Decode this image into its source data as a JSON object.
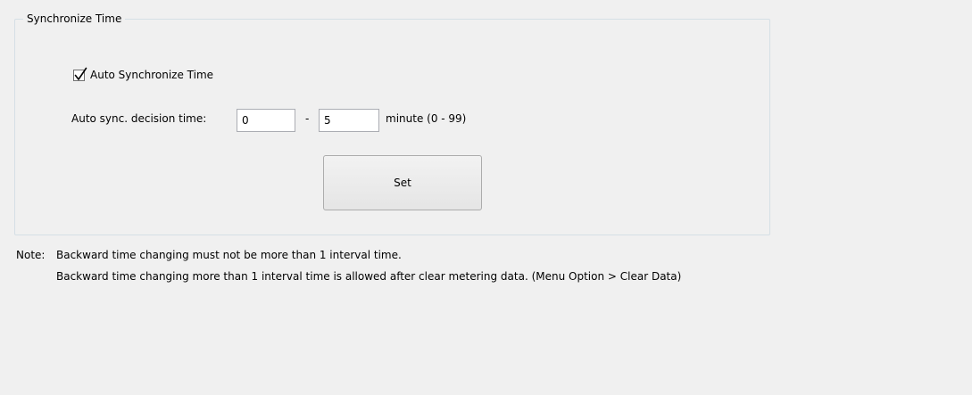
{
  "group": {
    "title": "Synchronize Time"
  },
  "auto_sync": {
    "label": "Auto Synchronize Time",
    "checked": true
  },
  "decision_time": {
    "label": "Auto sync. decision time:",
    "from_value": "0",
    "separator": "-",
    "to_value": "5",
    "unit_label": "minute  (0 - 99)"
  },
  "set_button": {
    "label": "Set"
  },
  "note": {
    "prefix": "Note:",
    "line1": "Backward time changing must not be more than 1 interval time.",
    "line2": "Backward time changing more than 1 interval time is allowed after clear metering data. (Menu Option > Clear Data)"
  }
}
